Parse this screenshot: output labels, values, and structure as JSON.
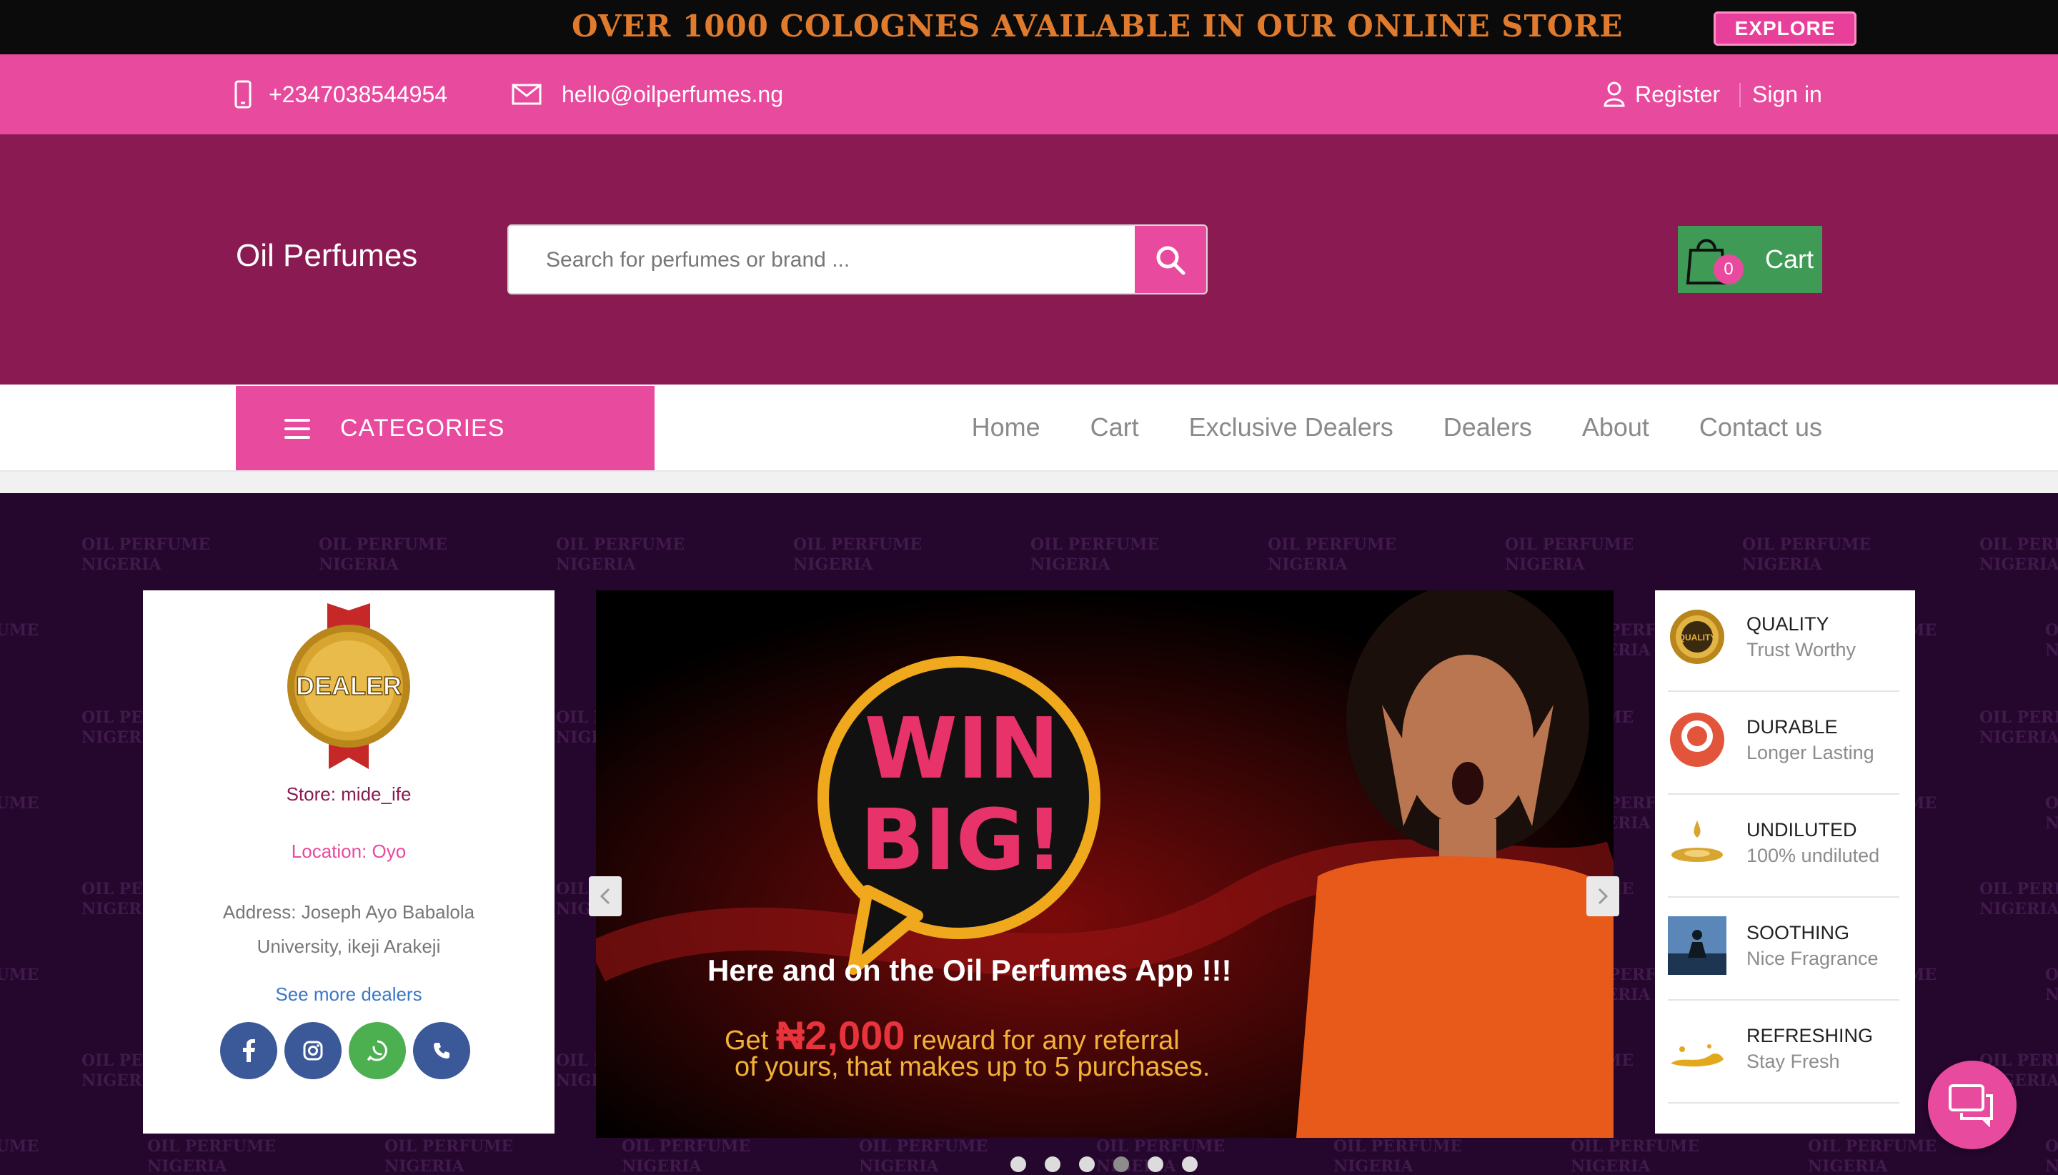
{
  "promo": {
    "text": "OVER 1000  COLOGNES AVAILABLE IN OUR ONLINE STORE",
    "button": "EXPLORE"
  },
  "contact": {
    "phone": "+2347038544954",
    "email": "hello@oilperfumes.ng",
    "register": "Register",
    "signin": "Sign in"
  },
  "header": {
    "logo": "Oil Perfumes",
    "search_placeholder": "Search for perfumes or brand ...",
    "cart_count": "0",
    "cart_label": "Cart"
  },
  "nav": {
    "categories": "CATEGORIES",
    "links": [
      "Home",
      "Cart",
      "Exclusive Dealers",
      "Dealers",
      "About",
      "Contact us"
    ]
  },
  "hero": {
    "watermark_line1": "OIL PERFUME",
    "watermark_line2": "NIGERIA"
  },
  "dealer": {
    "badge_text": "DEALER",
    "store": "Store: mide_ife",
    "location": "Location: Oyo",
    "address": "Address: Joseph Ayo Babalola University, ikeji Arakeji",
    "see_more": "See more dealers"
  },
  "banner": {
    "win": "WIN",
    "big": "BIG!",
    "headline": "Here and on the Oil Perfumes App !!!",
    "line1_pre": "Get ",
    "amount": "₦2,000",
    "line1_post": " reward for any referral",
    "line2": "of yours,  that makes up to 5 purchases."
  },
  "features": [
    {
      "title": "QUALITY",
      "subtitle": "Trust Worthy",
      "icon": "quality-seal-icon"
    },
    {
      "title": "DURABLE",
      "subtitle": "Longer Lasting",
      "icon": "durable-icon"
    },
    {
      "title": "UNDILUTED",
      "subtitle": "100% undiluted",
      "icon": "drop-icon"
    },
    {
      "title": "SOOTHING",
      "subtitle": "Nice Fragrance",
      "icon": "meditation-icon"
    },
    {
      "title": "REFRESHING",
      "subtitle": "Stay Fresh",
      "icon": "splash-icon"
    }
  ],
  "slider": {
    "dot_count": 6,
    "active_index": 3
  },
  "colors": {
    "pink": "#e84a9e",
    "plum": "#891a52",
    "green": "#3f9a55",
    "hero_bg": "#25062d",
    "facebook": "#3b5998",
    "instagram": "#3b5998",
    "whatsapp": "#4caf50",
    "phone": "#3b5998"
  }
}
